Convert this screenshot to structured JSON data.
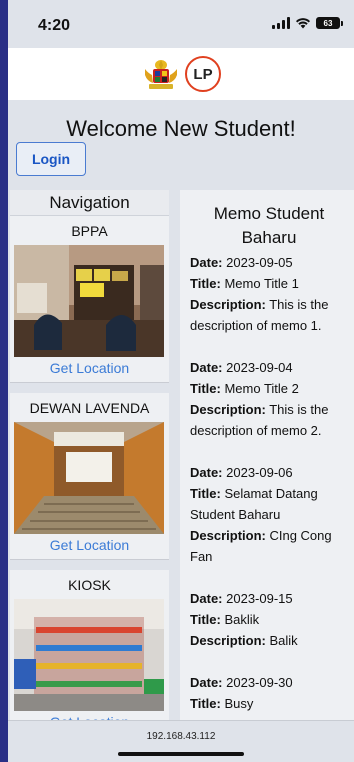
{
  "status": {
    "time": "4:20",
    "battery": "63"
  },
  "header": {
    "logo_lp_text": "LP"
  },
  "welcome": "Welcome New Student!",
  "login_label": "Login",
  "navigation": {
    "title": "Navigation",
    "items": [
      {
        "name": "BPPA",
        "link": "Get Location"
      },
      {
        "name": "DEWAN LAVENDA",
        "link": "Get Location"
      },
      {
        "name": "KIOSK",
        "link": "Get Location"
      }
    ]
  },
  "memo": {
    "title": "Memo Student Baharu",
    "labels": {
      "date": "Date:",
      "title": "Title:",
      "description": "Description:"
    },
    "items": [
      {
        "date": "2023-09-05",
        "title": "Memo Title 1",
        "description": "This is the description of memo 1."
      },
      {
        "date": "2023-09-04",
        "title": "Memo Title 2",
        "description": "This is the description of memo 2."
      },
      {
        "date": "2023-09-06",
        "title": "Selamat Datang Student Baharu",
        "description": "CIng Cong Fan"
      },
      {
        "date": "2023-09-15",
        "title": "Baklik",
        "description": "Balik"
      },
      {
        "date": "2023-09-30",
        "title": "Busy",
        "description": ""
      }
    ]
  },
  "url": "192.168.43.112"
}
